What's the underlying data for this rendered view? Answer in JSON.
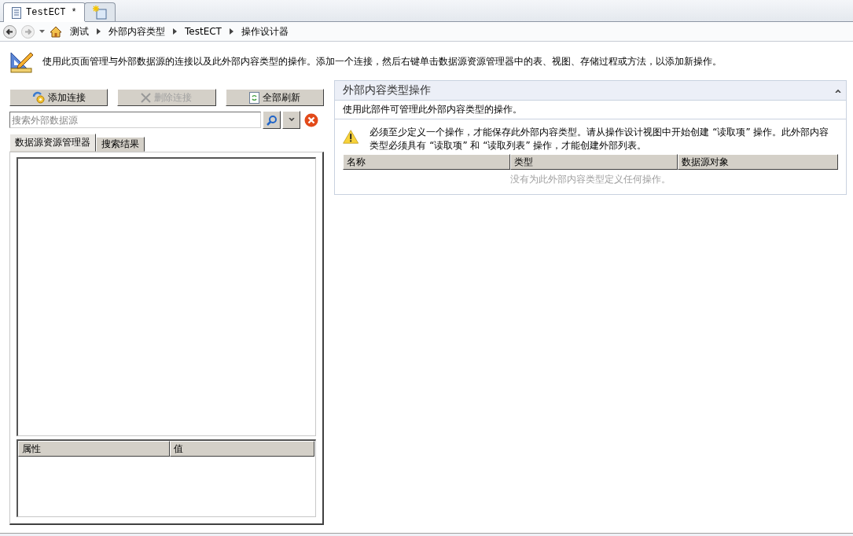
{
  "document_tabs": [
    {
      "kind": "document",
      "label": "TestECT *",
      "selected": true
    },
    {
      "kind": "new",
      "selected": false
    }
  ],
  "breadcrumb": [
    "测试",
    "外部内容类型",
    "TestECT",
    "操作设计器"
  ],
  "intro": "使用此页面管理与外部数据源的连接以及此外部内容类型的操作。添加一个连接，然后右键单击数据源资源管理器中的表、视图、存储过程或方法，以添加新操作。",
  "connection_buttons": [
    {
      "kind": "add",
      "label": "添加连接",
      "disabled": false
    },
    {
      "kind": "delete",
      "label": "删除连接",
      "disabled": true
    },
    {
      "kind": "refresh",
      "label": "全部刷新",
      "disabled": false
    }
  ],
  "search": {
    "placeholder": "搜索外部数据源"
  },
  "explorer_tabs": [
    {
      "label": "数据源资源管理器",
      "selected": true
    },
    {
      "label": "搜索结果",
      "selected": false
    }
  ],
  "properties_table": {
    "columns": [
      "属性",
      "值"
    ]
  },
  "operations_panel": {
    "title": "外部内容类型操作",
    "expanded": true,
    "description": "使用此部件可管理此外部内容类型的操作。",
    "warning": "必须至少定义一个操作，才能保存此外部内容类型。请从操作设计视图中开始创建 “读取项” 操作。此外部内容类型必须具有 “读取项” 和 “读取列表” 操作，才能创建外部列表。",
    "columns": [
      "名称",
      "类型",
      "数据源对象"
    ],
    "empty_message": "没有为此外部内容类型定义任何操作。"
  }
}
